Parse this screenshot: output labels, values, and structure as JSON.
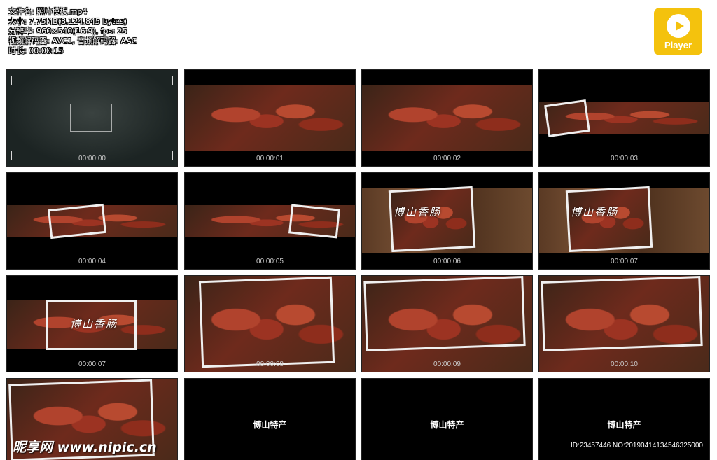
{
  "file_info": {
    "filename": "文件名: 照片模板.mp4",
    "size": "大小: 7.75MB(8,124,845 bytes)",
    "resolution": "分辨率: 960×540(16:9), fps: 25",
    "codec": "视频解码器: AVC1, 音频解码器: AAC",
    "duration": "时长: 00:00:15"
  },
  "player_button": {
    "label": "Player"
  },
  "thumbnails": [
    {
      "time": "00:00:00"
    },
    {
      "time": "00:00:01"
    },
    {
      "time": "00:00:02"
    },
    {
      "time": "00:00:03"
    },
    {
      "time": "00:00:04"
    },
    {
      "time": "00:00:05"
    },
    {
      "time": "00:00:06",
      "caption": "博山香肠"
    },
    {
      "time": "00:00:07",
      "caption": "博山香肠"
    },
    {
      "time": "00:00:07",
      "caption": "博山香肠"
    },
    {
      "time": "00:00:08"
    },
    {
      "time": "00:00:09"
    },
    {
      "time": "00:00:10"
    },
    {
      "time": ""
    },
    {
      "time": "",
      "title": "博山特产"
    },
    {
      "time": "",
      "title": "博山特产"
    },
    {
      "time": "",
      "title": "博山特产"
    }
  ],
  "watermark": {
    "text": "昵享网 www.nipic.cn"
  },
  "image_id": "ID:23457446 NO:20190414134546325000"
}
